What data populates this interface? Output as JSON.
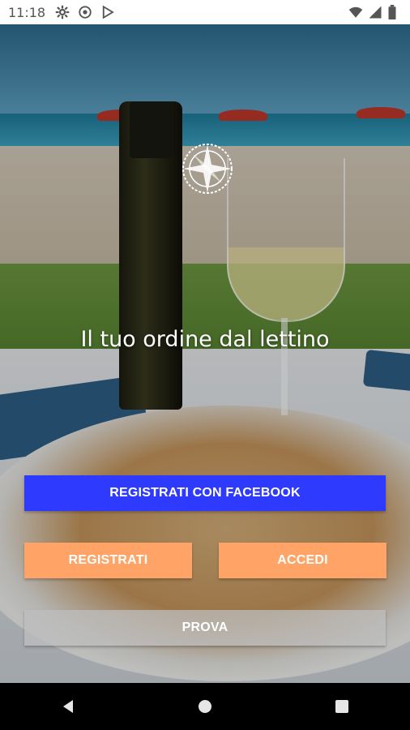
{
  "status_bar": {
    "time": "11:18",
    "left_icons": [
      "gear-icon",
      "vpn-icon",
      "play-store-icon"
    ],
    "right_icons": [
      "wifi-icon",
      "signal-icon",
      "battery-icon"
    ]
  },
  "hero": {
    "tagline": "Il tuo ordine dal lettino"
  },
  "actions": {
    "facebook_label": "REGISTRATI CON FACEBOOK",
    "register_label": "REGISTRATI",
    "login_label": "ACCEDI",
    "try_label": "PROVA"
  },
  "colors": {
    "facebook": "#2e3bff",
    "primary": "#ffa466",
    "secondary": "#bebebe"
  },
  "nav_bar": {
    "buttons": [
      "back-icon",
      "home-icon",
      "recents-icon"
    ]
  }
}
